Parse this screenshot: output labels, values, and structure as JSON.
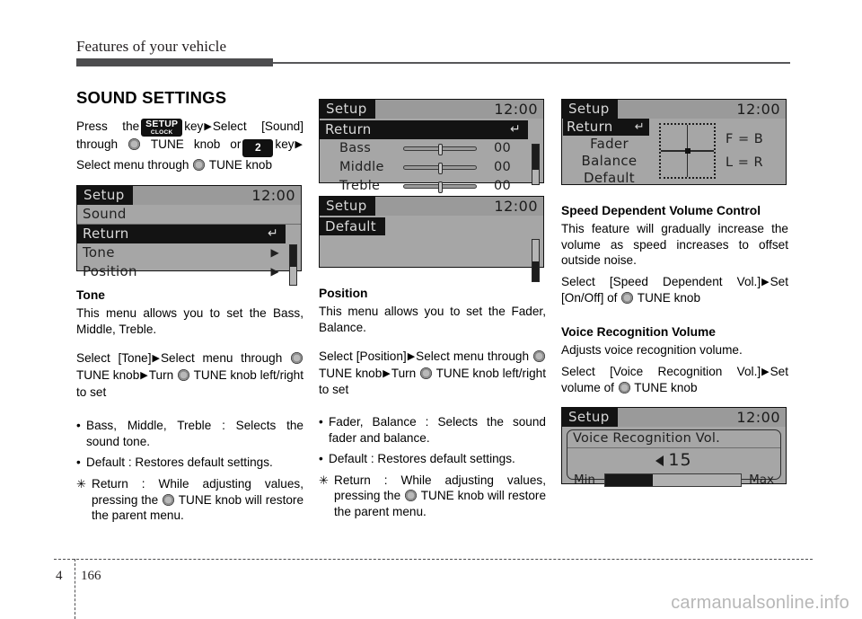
{
  "header": {
    "title": "Features of your vehicle"
  },
  "footer": {
    "chapter": "4",
    "page": "166",
    "watermark": "carmanualsonline.info"
  },
  "col1": {
    "section_title": "SOUND SETTINGS",
    "intro": {
      "t1": "Press the",
      "key_setup_top": "SETUP",
      "key_setup_bottom": "CLOCK",
      "t2": "key",
      "arrow1": "▶",
      "t3": "Select [Sound] through",
      "t4": "TUNE knob or",
      "key_num": "2",
      "t5": "key",
      "arrow2": "▶",
      "t6": "Select menu through",
      "t7": "TUNE knob"
    },
    "lcd_sound": {
      "tab": "Setup",
      "clock": "12:00",
      "subheader": "Sound",
      "rows": [
        {
          "label": "Return",
          "arrow": "↵",
          "selected": true
        },
        {
          "label": "Tone",
          "arrow": "▶",
          "selected": false
        },
        {
          "label": "Position",
          "arrow": "▶",
          "selected": false
        }
      ]
    },
    "tone": {
      "heading": "Tone",
      "desc": "This menu allows you to set the Bass, Middle, Treble.",
      "step_a": "Select [Tone]",
      "step_arrow1": "▶",
      "step_b": "Select menu through",
      "step_c": "TUNE knob",
      "step_arrow2": "▶",
      "step_d": "Turn",
      "step_e": "TUNE knob left/right to set",
      "bullets": [
        {
          "mark": "•",
          "text": "Bass, Middle, Treble : Selects the sound tone."
        },
        {
          "mark": "•",
          "text": "Default : Restores default settings."
        }
      ],
      "note": {
        "mark": "✳",
        "t1": "Return : While adjusting values, pressing the",
        "t2": "TUNE knob will restore the parent menu."
      }
    }
  },
  "col2": {
    "lcd_tone": {
      "tab": "Setup",
      "clock": "12:00",
      "selected_row": {
        "label": "Return",
        "arrow": "↵"
      },
      "sliders": [
        {
          "label": "Bass",
          "value": "00",
          "pos": 50
        },
        {
          "label": "Middle",
          "value": "00",
          "pos": 50
        },
        {
          "label": "Treble",
          "value": "00",
          "pos": 50
        }
      ]
    },
    "lcd_default": {
      "tab": "Setup",
      "clock": "12:00",
      "item": "Default"
    },
    "position": {
      "heading": "Position",
      "desc": "This menu allows you to set the Fader, Balance.",
      "step_a": "Select",
      "step_b": "[Position]",
      "step_arrow1": "▶",
      "step_c": "Select",
      "step_d": "menu",
      "step_e": "through",
      "step_f": "TUNE",
      "step_g": "knob",
      "step_arrow2": "▶",
      "step_h": "Turn",
      "step_i": "TUNE knob left/right to set",
      "bullets": [
        {
          "mark": "•",
          "text": "Fader, Balance : Selects the sound fader and balance."
        },
        {
          "mark": "•",
          "text": "Default : Restores default settings."
        }
      ],
      "note": {
        "mark": "✳",
        "t1": "Return : While adjusting values, pressing the",
        "t2": "TUNE knob will restore the parent menu."
      }
    }
  },
  "col3": {
    "lcd_position": {
      "tab": "Setup",
      "clock": "12:00",
      "items": [
        {
          "label": "Return",
          "arrow": "↵",
          "selected": true
        },
        {
          "label": "Fader",
          "selected": false
        },
        {
          "label": "Balance",
          "selected": false
        },
        {
          "label": "Default",
          "selected": false
        }
      ],
      "legend_top": "F = B",
      "legend_bottom": "L = R"
    },
    "speed_volume": {
      "heading": "Speed Dependent Volume Control",
      "desc": "This feature will gradually increase the volume as speed increases to offset outside noise.",
      "step_a": "Select [Speed Dependent Vol.]",
      "step_arrow": "▶",
      "step_b": "Set [On/Off] of",
      "step_c": "TUNE knob"
    },
    "voice_volume": {
      "heading": "Voice Recognition Volume",
      "desc": "Adjusts voice recognition volume.",
      "step_a": "Select [Voice Recognition Vol.]",
      "step_arrow": "▶",
      "step_b": "Set volume of",
      "step_c": "TUNE knob"
    },
    "lcd_voice": {
      "tab": "Setup",
      "clock": "12:00",
      "title": "Voice Recognition Vol.",
      "value": "15",
      "min_label": "Min",
      "max_label": "Max",
      "fill_percent": 35
    }
  }
}
